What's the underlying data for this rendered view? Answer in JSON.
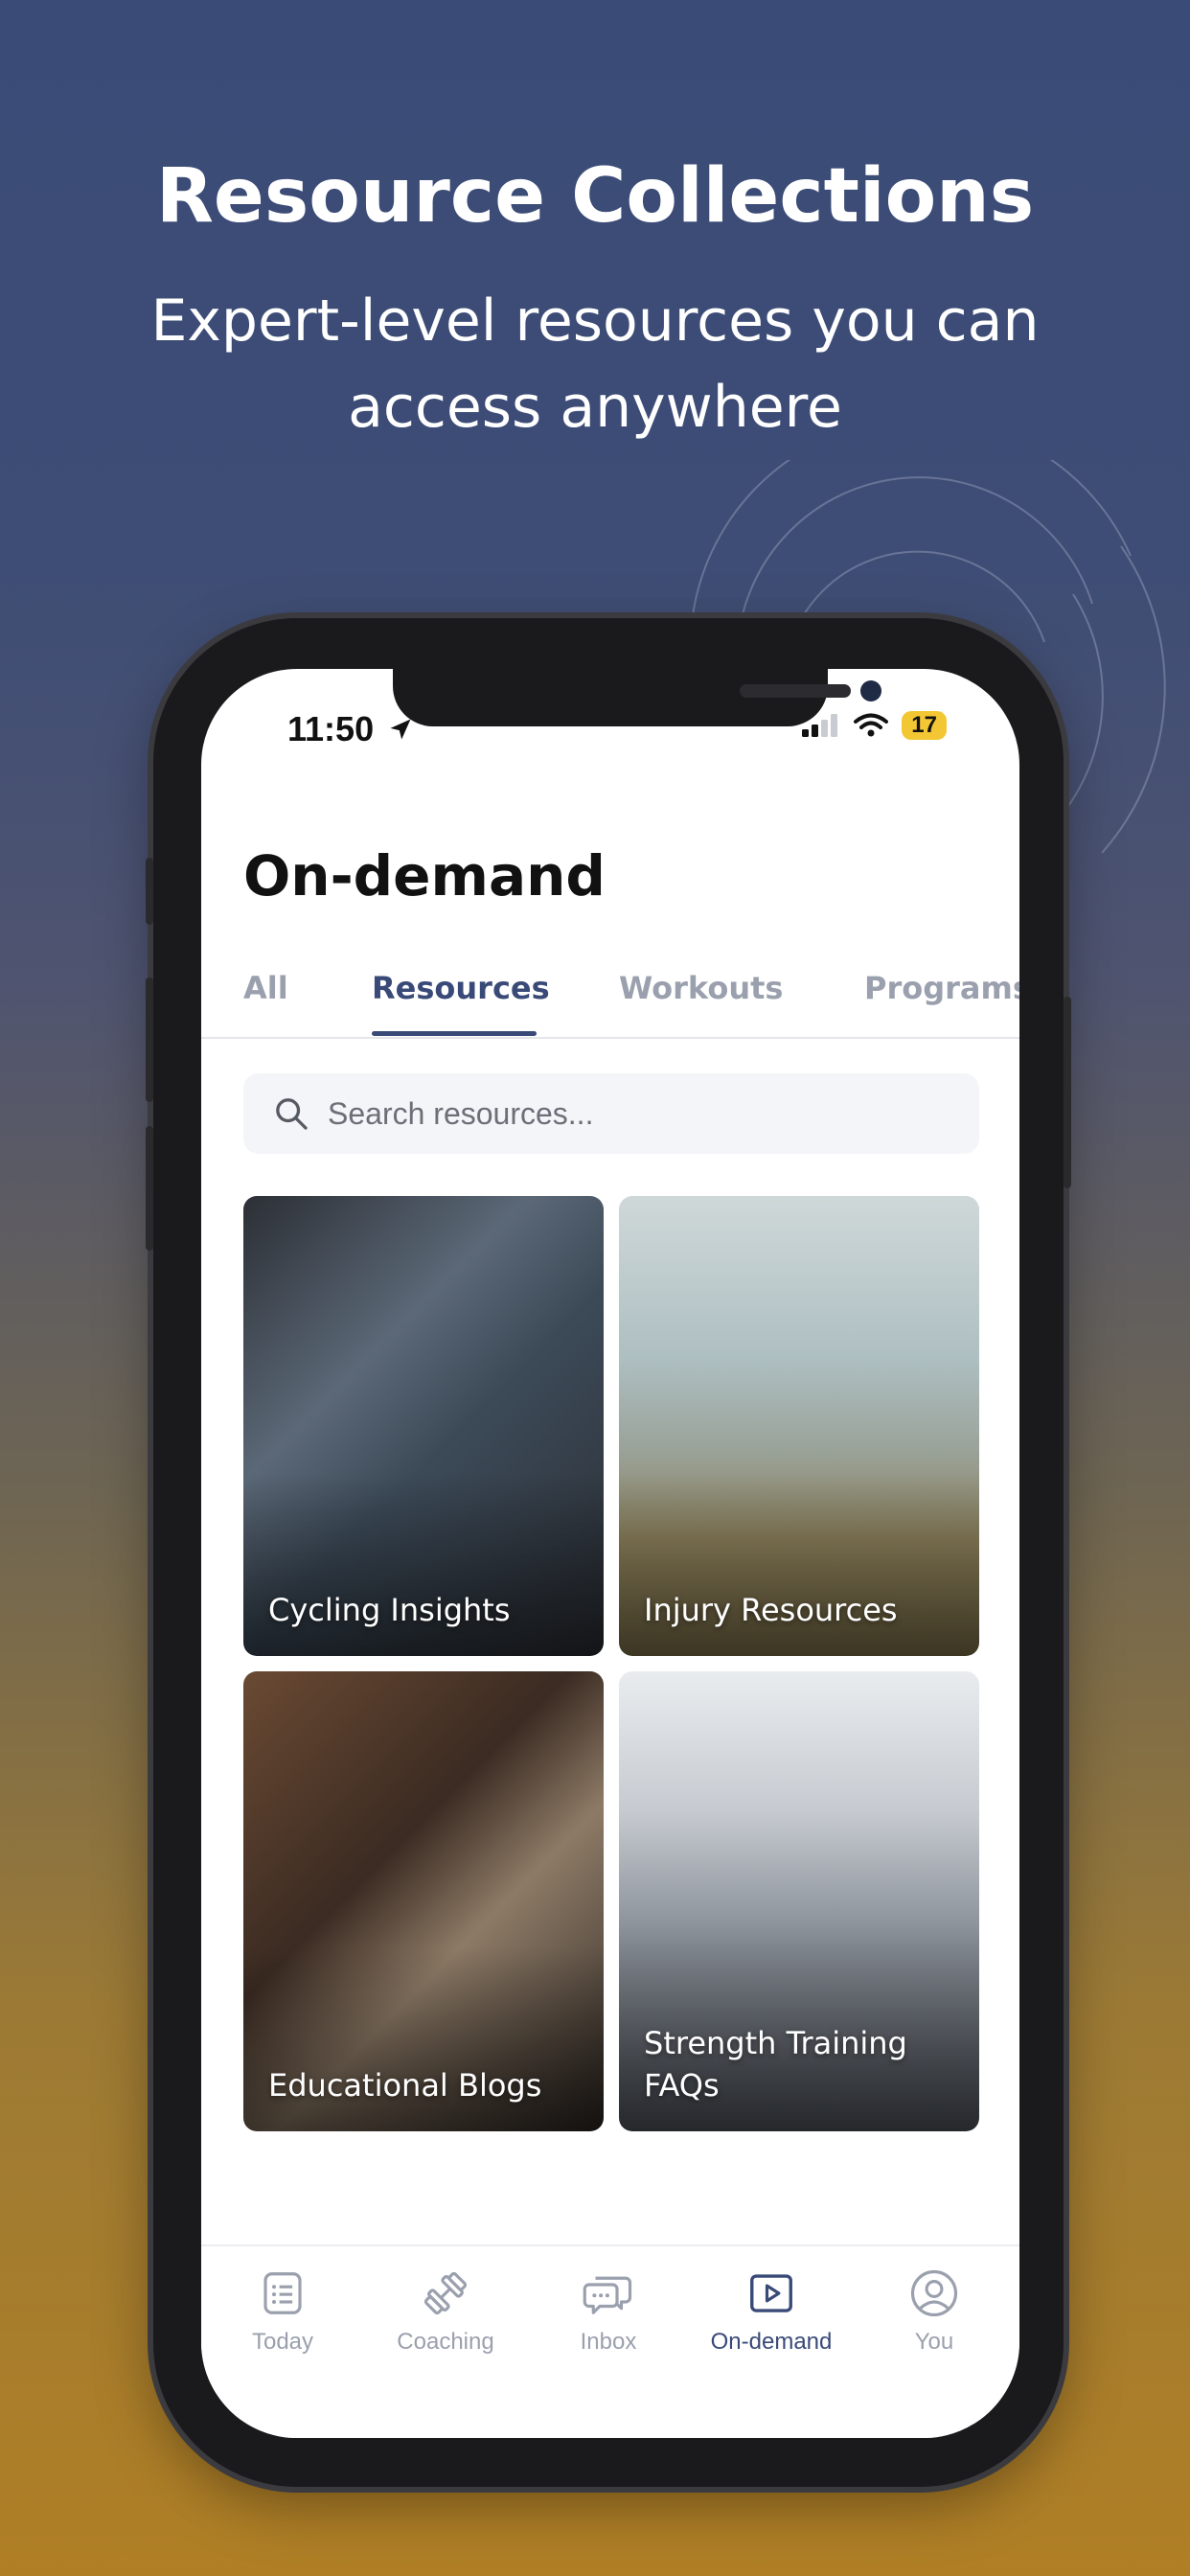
{
  "promo": {
    "title": "Resource Collections",
    "subtitle": "Expert-level resources you can access anywhere"
  },
  "status_bar": {
    "time": "11:50",
    "battery": "17"
  },
  "page": {
    "title": "On-demand"
  },
  "tabs": [
    {
      "label": "All",
      "active": false
    },
    {
      "label": "Resources",
      "active": true
    },
    {
      "label": "Workouts",
      "active": false
    },
    {
      "label": "Programs",
      "active": false
    }
  ],
  "search": {
    "placeholder": "Search resources..."
  },
  "cards": [
    {
      "label": "Cycling Insights"
    },
    {
      "label": "Injury Resources"
    },
    {
      "label": "Educational Blogs"
    },
    {
      "label": "Strength Training FAQs"
    }
  ],
  "bottom_nav": [
    {
      "label": "Today",
      "icon": "list-icon"
    },
    {
      "label": "Coaching",
      "icon": "dumbbell-icon"
    },
    {
      "label": "Inbox",
      "icon": "chat-icon"
    },
    {
      "label": "On-demand",
      "icon": "play-icon",
      "active": true
    },
    {
      "label": "You",
      "icon": "user-icon"
    }
  ],
  "colors": {
    "accent": "#3a4a78",
    "inactive": "#9aa0ad",
    "battery": "#f3c633"
  }
}
